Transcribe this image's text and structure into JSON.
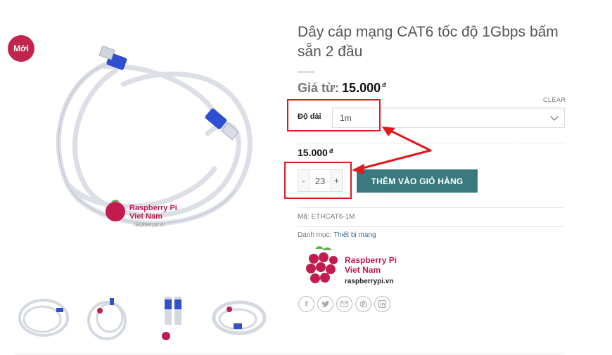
{
  "badge": {
    "label": "Mới"
  },
  "product": {
    "title": "Dây cáp mạng CAT6 tốc độ 1Gbps bấm sẵn 2 đầu",
    "price_from_label": "Giá từ:",
    "price_from_value": "15.000",
    "currency": "đ"
  },
  "variation": {
    "label": "Độ dài",
    "selected": "1m",
    "clear_label": "CLEAR"
  },
  "selected_price": {
    "value": "15.000",
    "currency": "đ"
  },
  "quantity": {
    "minus": "-",
    "value": "23",
    "plus": "+"
  },
  "cart_button": {
    "label": "THÊM VÀO GIỎ HÀNG"
  },
  "meta": {
    "sku_label": "Mã:",
    "sku": "ETHCAT6-1M",
    "category_label": "Danh mục:",
    "category": "Thiết bị mạng"
  },
  "brand": {
    "line1": "Raspberry Pi",
    "line2": "Viet Nam",
    "url": "raspberrypi.vn"
  },
  "share_icons": [
    "facebook-icon",
    "twitter-icon",
    "email-icon",
    "pinterest-icon",
    "linkedin-icon"
  ],
  "colors": {
    "badge": "#c0264b",
    "button": "#3a7a7e",
    "highlight": "#e0191f",
    "link": "#3a6a95"
  }
}
